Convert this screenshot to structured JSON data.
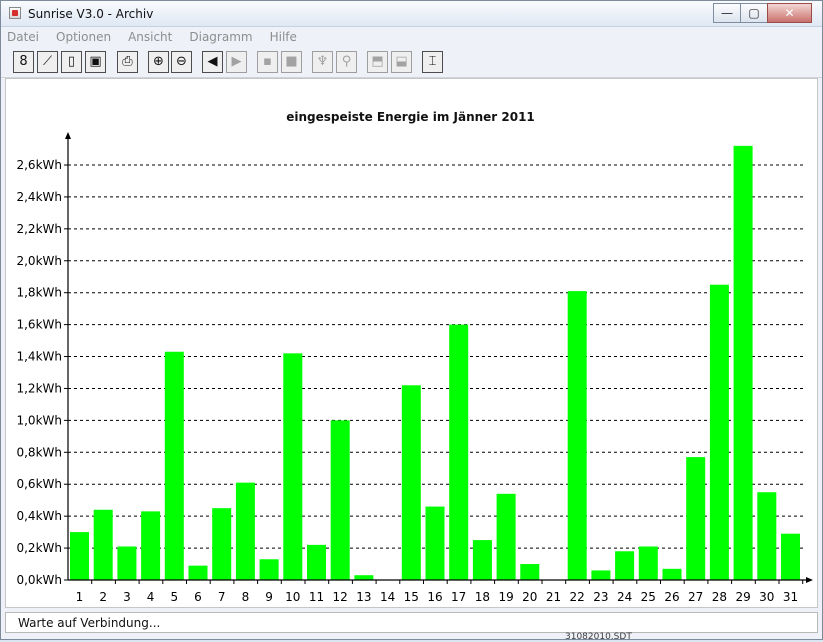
{
  "window": {
    "title": "Sunrise V3.0 - Archiv",
    "minimize_glyph": "—",
    "maximize_glyph": "▢",
    "close_glyph": "✕"
  },
  "menu": {
    "items": [
      "Datei",
      "Optionen",
      "Ansicht",
      "Diagramm",
      "Hilfe"
    ]
  },
  "toolbar": {
    "buttons": [
      {
        "icon": "chain-icon",
        "glyph": "8",
        "enabled": true
      },
      {
        "icon": "line-chart-icon",
        "glyph": "⟋",
        "enabled": true
      },
      {
        "icon": "page-icon",
        "glyph": "▯",
        "enabled": true
      },
      {
        "icon": "windows-icon",
        "glyph": "▣",
        "enabled": true
      },
      {
        "icon": "printer-icon",
        "glyph": "⎙",
        "enabled": true
      },
      {
        "icon": "zoom-in-icon",
        "glyph": "⊕",
        "enabled": true
      },
      {
        "icon": "zoom-out-icon",
        "glyph": "⊖",
        "enabled": true
      },
      {
        "icon": "previous-icon",
        "glyph": "◀",
        "enabled": true
      },
      {
        "icon": "next-icon",
        "glyph": "▶",
        "enabled": false
      },
      {
        "icon": "sign-icon",
        "glyph": "▪",
        "enabled": false
      },
      {
        "icon": "square-icon",
        "glyph": "■",
        "enabled": false
      },
      {
        "icon": "plug-icon",
        "glyph": "♆",
        "enabled": false
      },
      {
        "icon": "plug-wire-icon",
        "glyph": "⚲",
        "enabled": false
      },
      {
        "icon": "panel-up-icon",
        "glyph": "⬒",
        "enabled": false
      },
      {
        "icon": "panel-down-icon",
        "glyph": "⬓",
        "enabled": false
      },
      {
        "icon": "thermometer-icon",
        "glyph": "⌶",
        "enabled": true
      }
    ]
  },
  "status": {
    "text": "Warte auf Verbindung...",
    "peek_text": "31082010.SDT"
  },
  "colors": {
    "bar": "#00ff00",
    "grid": "#000000"
  },
  "chart_data": {
    "type": "bar",
    "title": "eingespeiste Energie im Jänner 2011",
    "xlabel": "",
    "ylabel": "",
    "ylim": [
      0,
      2.6
    ],
    "grid": "dashed horizontal",
    "categories": [
      "1",
      "2",
      "3",
      "4",
      "5",
      "6",
      "7",
      "8",
      "9",
      "10",
      "11",
      "12",
      "13",
      "14",
      "15",
      "16",
      "17",
      "18",
      "19",
      "20",
      "21",
      "22",
      "23",
      "24",
      "25",
      "26",
      "27",
      "28",
      "29",
      "30",
      "31"
    ],
    "values": [
      0.3,
      0.44,
      0.21,
      0.43,
      1.43,
      0.09,
      0.45,
      0.61,
      0.13,
      1.42,
      0.22,
      1.0,
      0.03,
      0.0,
      1.22,
      0.46,
      1.6,
      0.25,
      0.54,
      0.1,
      0.0,
      1.81,
      0.06,
      0.18,
      0.21,
      0.07,
      0.77,
      1.85,
      2.72,
      0.55,
      0.29
    ],
    "y_ticks": [
      "0,0kWh",
      "0,2kWh",
      "0,4kWh",
      "0,6kWh",
      "0,8kWh",
      "1,0kWh",
      "1,2kWh",
      "1,4kWh",
      "1,6kWh",
      "1,8kWh",
      "2,0kWh",
      "2,2kWh",
      "2,4kWh",
      "2,6kWh"
    ]
  }
}
